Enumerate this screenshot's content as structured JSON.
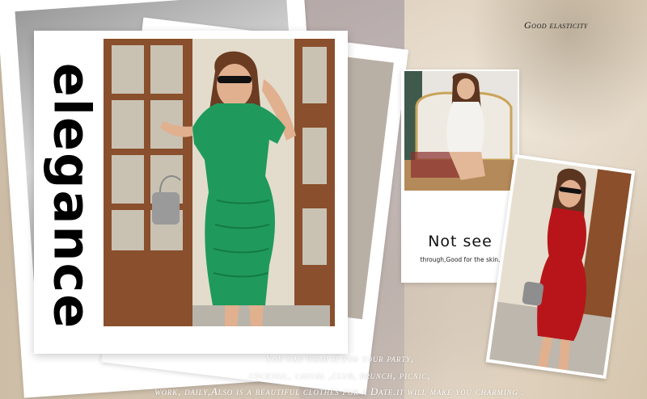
{
  "main_word": "elegance",
  "caption_top": "Good elasticity",
  "card_feature": {
    "title": "Not see",
    "subtitle": "through,Good for the skin."
  },
  "bottom_text": {
    "line1": "You can wear it for your party,",
    "line2": "cocktail, casual ,club, brunch, picnic,",
    "line3": "work, daily,Also is a beautiful clothes for a Date.it will make you charming ."
  },
  "colors": {
    "green_dress": "#1f9a5c",
    "red_dress": "#b8151b",
    "white_dress": "#f4f2ee"
  }
}
